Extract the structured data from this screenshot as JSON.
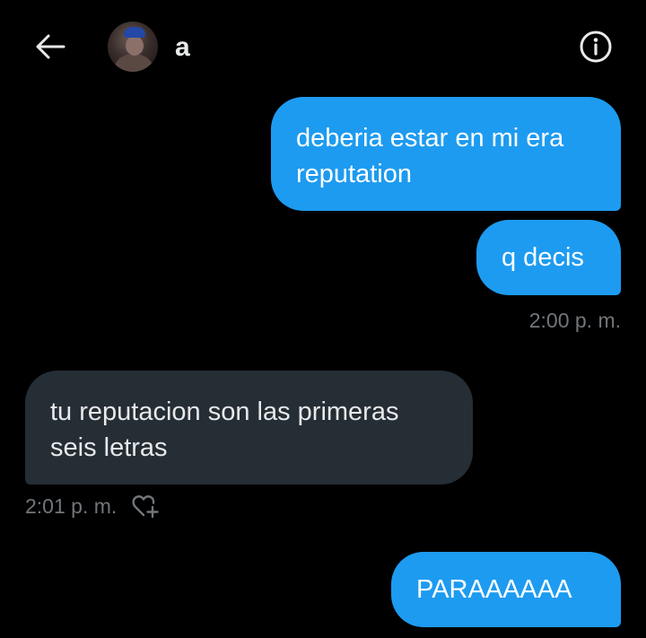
{
  "header": {
    "back_icon": "arrow-left-icon",
    "contact_name": "a",
    "info_icon": "info-icon"
  },
  "messages": [
    {
      "direction": "sent",
      "lines": [
        "deberia estar en mi era",
        "reputation"
      ]
    },
    {
      "direction": "sent",
      "lines": [
        "q decis"
      ]
    },
    {
      "direction": "received",
      "lines": [
        "tu reputacion son las primeras",
        "seis letras"
      ]
    },
    {
      "direction": "sent",
      "lines": [
        "PARAAAAAA"
      ]
    }
  ],
  "timestamps": {
    "sent_group": "2:00 p. m.",
    "received": "2:01 p. m."
  },
  "reaction_icon": "heart-plus-icon",
  "colors": {
    "background": "#000000",
    "sent_bubble": "#1d9bf0",
    "received_bubble": "#252d35",
    "text": "#e7e9ea",
    "muted": "#71767b"
  }
}
